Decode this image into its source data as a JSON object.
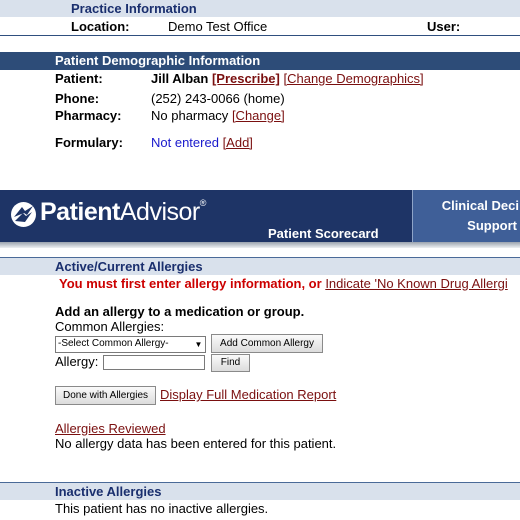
{
  "practice": {
    "header": "Practice Information",
    "location_label": "Location:",
    "location_value": "Demo Test Office",
    "user_label": "User:"
  },
  "demographics": {
    "header": "Patient Demographic Information",
    "patient_label": "Patient:",
    "patient_name": "Jill Alban",
    "prescribe_link": "[Prescribe]",
    "change_demographics_link": "[Change Demographics]",
    "phone_label": "Phone:",
    "phone_value": "(252) 243-0066 (home)",
    "pharmacy_label": "Pharmacy:",
    "pharmacy_value": "No pharmacy",
    "pharmacy_change_link": "[Change]",
    "formulary_label": "Formulary:",
    "formulary_value": "Not entered",
    "formulary_add_link": "[Add]"
  },
  "banner": {
    "logo_bold": "Patient",
    "logo_light": "Advisor",
    "logo_reg": "®",
    "scorecard": "Patient Scorecard",
    "cds_line1": "Clinical Deci",
    "cds_line2": "Support"
  },
  "allergies": {
    "header": "Active/Current Allergies",
    "warning": "You must first enter allergy information, or",
    "nka_link": "Indicate 'No Known Drug Allergi",
    "add_title": "Add an allergy to a medication or group.",
    "common_label": "Common Allergies:",
    "common_select_value": "-Select Common Allergy-",
    "add_common_button": "Add Common Allergy",
    "allergy_label": "Allergy:",
    "allergy_input_value": "",
    "find_button": "Find",
    "done_button": "Done with Allergies",
    "full_report_link": "Display Full Medication Report",
    "reviewed_link": "Allergies Reviewed",
    "no_data_text": "No allergy data has been entered for this patient."
  },
  "inactive": {
    "header": "Inactive Allergies",
    "text": "This patient has no inactive allergies."
  },
  "colors": {
    "link": "#7a0f0f",
    "warning": "#cc0000",
    "header_dark": "#2d4c78",
    "header_light": "#d9e1ec",
    "banner": "#1e3466",
    "not_entered": "#1a1acc"
  }
}
